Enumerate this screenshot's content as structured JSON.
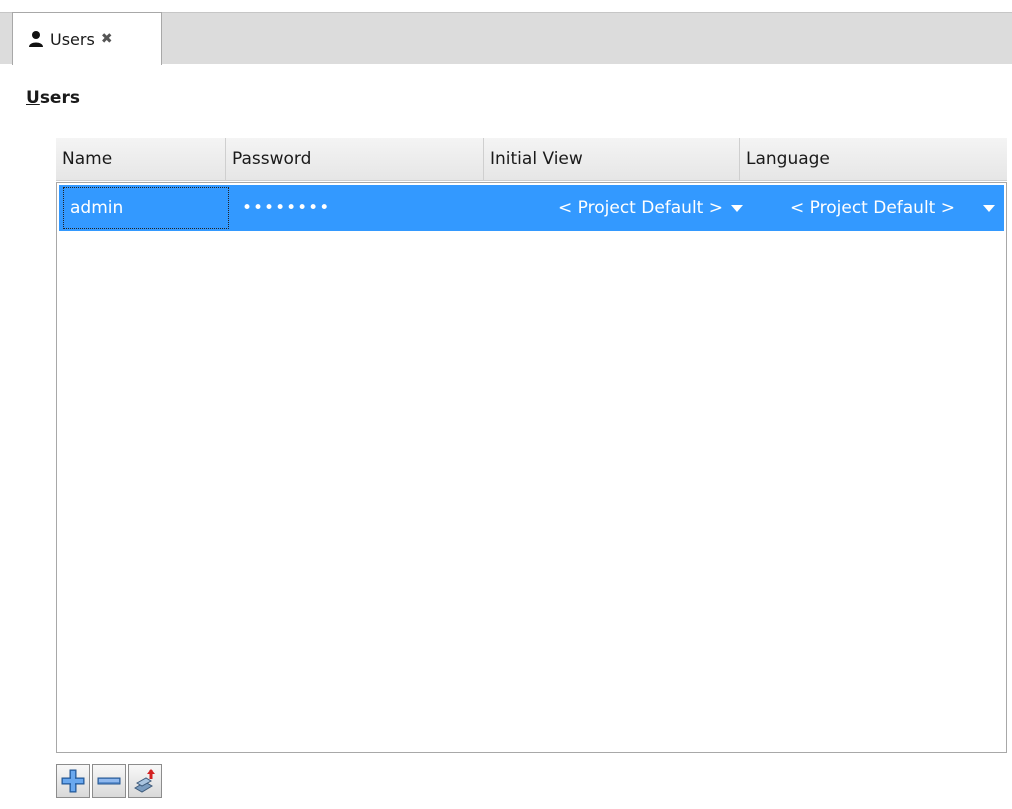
{
  "tab": {
    "label": "Users",
    "close_glyph": "✖",
    "icon": "user-icon"
  },
  "section": {
    "title_underlined": "U",
    "title_rest": "sers"
  },
  "table": {
    "columns": [
      "Name",
      "Password",
      "Initial View",
      "Language"
    ],
    "rows": [
      {
        "name": "admin",
        "password": "••••••••",
        "initial_view": "< Project Default >",
        "language": "< Project Default >"
      }
    ]
  },
  "toolbar": {
    "add_icon": "plus-icon",
    "remove_icon": "minus-icon",
    "import_icon": "import-users-icon"
  },
  "colors": {
    "selection": "#3399ff",
    "tabbar": "#dcdcdc",
    "add": "#3a7fd0",
    "remove": "#5b8fd0",
    "import_arrow": "#d32020"
  }
}
